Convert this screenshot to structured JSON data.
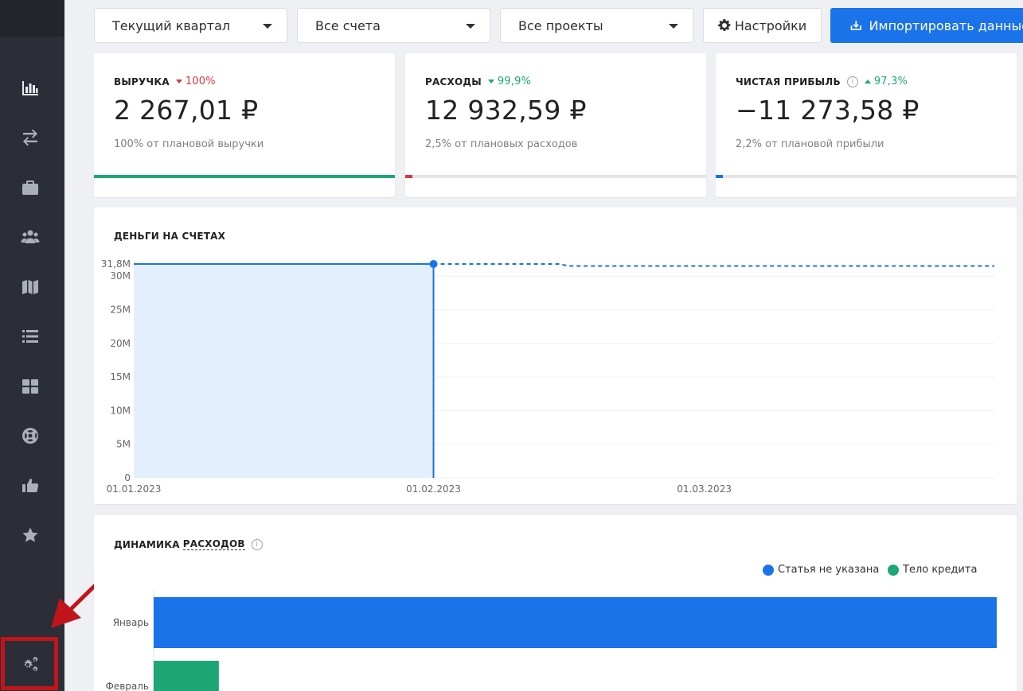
{
  "sidebar": {
    "items": [
      {
        "name": "reports",
        "icon": "bar-chart-icon"
      },
      {
        "name": "transactions",
        "icon": "transfer-arrows-icon"
      },
      {
        "name": "projects",
        "icon": "briefcase-icon"
      },
      {
        "name": "contractors",
        "icon": "users-icon"
      },
      {
        "name": "map",
        "icon": "map-icon"
      },
      {
        "name": "list",
        "icon": "list-icon"
      },
      {
        "name": "dashboard",
        "icon": "grid-icon"
      },
      {
        "name": "help",
        "icon": "life-ring-icon"
      },
      {
        "name": "likes",
        "icon": "thumbs-up-icon"
      },
      {
        "name": "favorites",
        "icon": "star-icon"
      }
    ],
    "settings_icon": "gears-icon"
  },
  "filters": {
    "period": "Текущий квартал",
    "accounts": "Все счета",
    "projects": "Все проекты",
    "settings_label": "Настройки",
    "import_label": "Импортировать данные"
  },
  "kpis": [
    {
      "label": "ВЫРУЧКА",
      "delta": "100%",
      "direction": "down",
      "delta_color": "#d9363e",
      "value": "2 267,01 ₽",
      "sub": "100% от плановой выручки",
      "progress": 1.0,
      "bar_color": "#1ea774"
    },
    {
      "label": "РАСХОДЫ",
      "delta": "99,9%",
      "direction": "down",
      "delta_color": "#1ea774",
      "value": "12 932,59 ₽",
      "sub": "2,5% от плановых расходов",
      "progress": 0.025,
      "bar_color": "#d9363e"
    },
    {
      "label": "ЧИСТАЯ ПРИБЫЛЬ",
      "delta": "97,3%",
      "direction": "up",
      "delta_color": "#1ea774",
      "value": "−11 273,58 ₽",
      "sub": "2,2% от плановой прибыли",
      "progress": 0.022,
      "bar_color": "#1a73e8"
    }
  ],
  "money_chart": {
    "title": "ДЕНЬГИ НА СЧЕТАХ",
    "chart_data": {
      "type": "area",
      "title": "ДЕНЬГИ НА СЧЕТАХ",
      "y_ticks": [
        "0",
        "5M",
        "10M",
        "15M",
        "20M",
        "25M",
        "30M"
      ],
      "y_top_label": "31,8M",
      "x_ticks": [
        "01.01.2023",
        "01.02.2023",
        "01.03.2023"
      ],
      "ylim": [
        0,
        31.8
      ],
      "y_unit": "M",
      "actual": [
        {
          "x": "2023-01-01",
          "y": 31.8
        },
        {
          "x": "2023-02-01",
          "y": 31.8
        }
      ],
      "forecast": [
        {
          "x": "2023-02-01",
          "y": 31.8
        },
        {
          "x": "2023-02-14",
          "y": 31.8
        },
        {
          "x": "2023-02-15",
          "y": 31.5
        },
        {
          "x": "2023-03-31",
          "y": 31.5
        }
      ],
      "x_range": [
        "2023-01-01",
        "2023-03-31"
      ],
      "line_color": "#1a73e8",
      "area_color": "#e3effc"
    }
  },
  "expenses_chart": {
    "title_prefix": "ДИНАМИКА",
    "title_link": "РАСХОДОВ",
    "chart_data": {
      "type": "bar",
      "orientation": "horizontal",
      "categories": [
        "Январь",
        "Февраль"
      ],
      "series": [
        {
          "name": "Статья не указана",
          "color": "#1a73e8",
          "values": [
            12932.59,
            0
          ]
        },
        {
          "name": "Тело кредита",
          "color": "#1ea774",
          "values": [
            0,
            1000
          ]
        }
      ],
      "xlim": [
        0,
        12932.59
      ]
    }
  }
}
